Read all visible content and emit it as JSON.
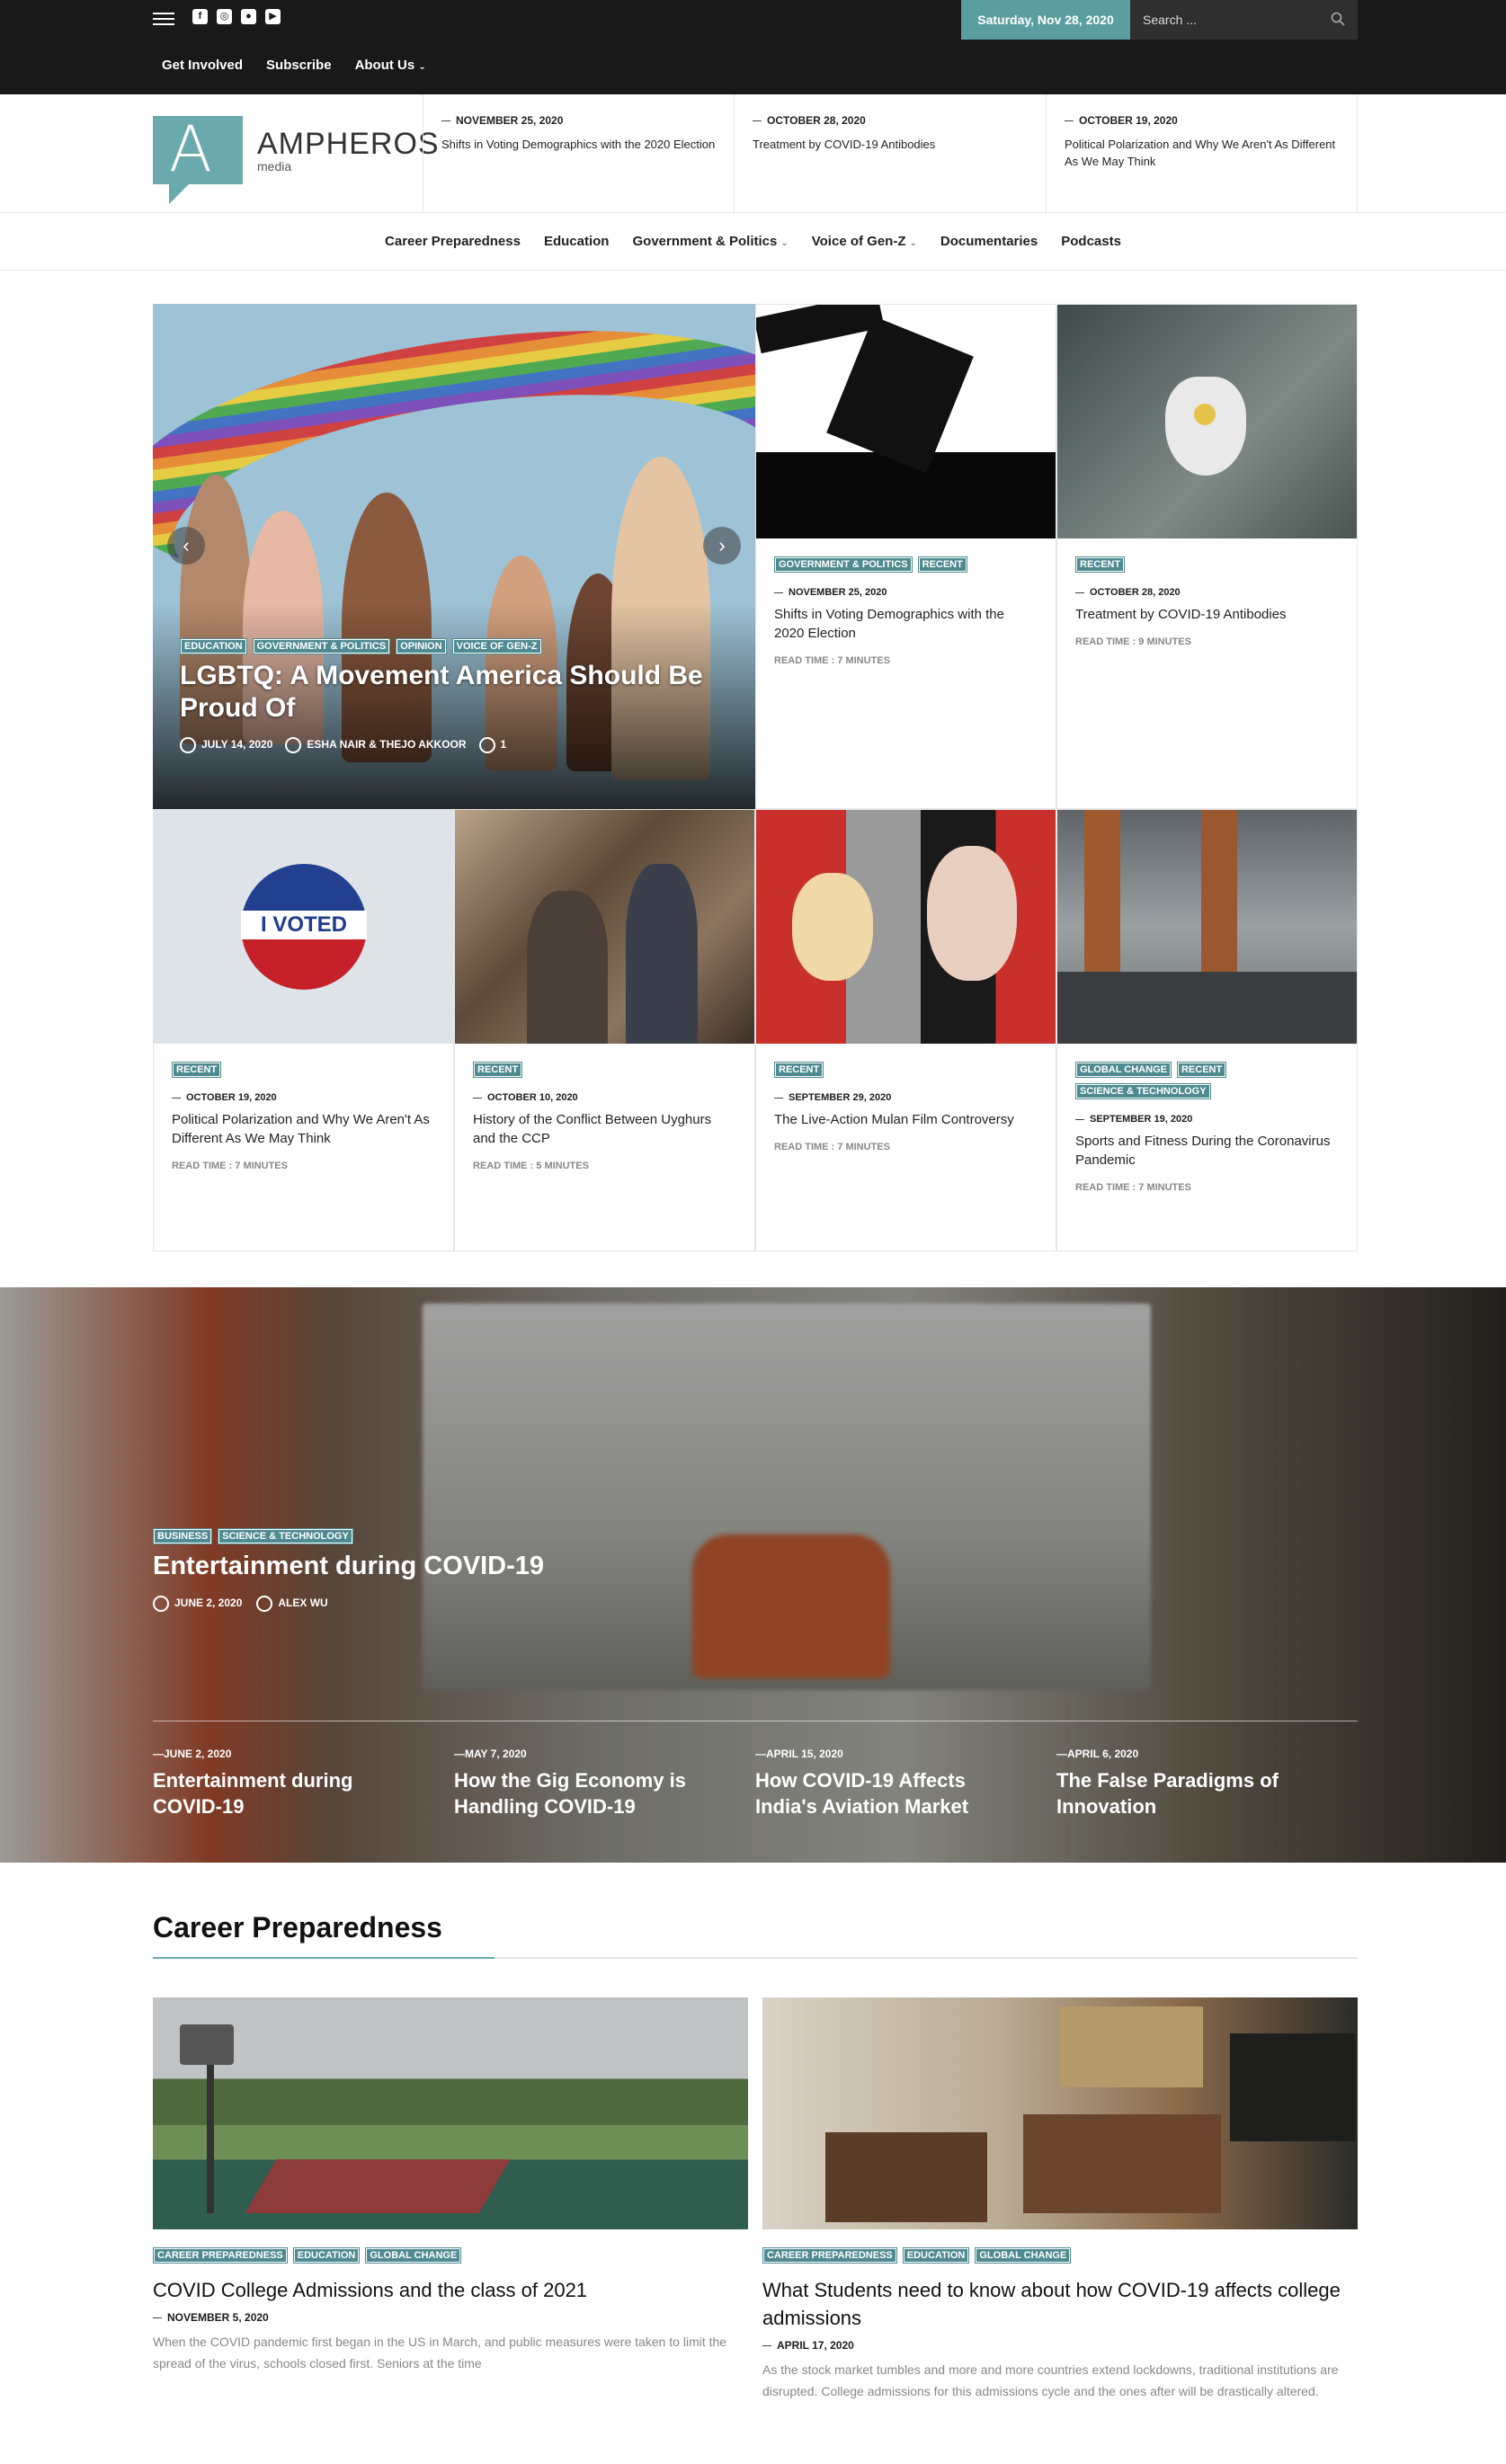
{
  "topbar": {
    "social_icons": [
      "facebook-icon",
      "instagram-icon",
      "reddit-icon",
      "youtube-icon"
    ],
    "date": "Saturday, Nov 28, 2020",
    "search_placeholder": "Search ...",
    "nav": [
      "Get Involved",
      "Subscribe",
      "About Us"
    ]
  },
  "logo": {
    "name": "AMPHEROS",
    "sub": "media"
  },
  "header_news": [
    {
      "date": "NOVEMBER 25, 2020",
      "title": "Shifts in Voting Demographics with the 2020 Election"
    },
    {
      "date": "OCTOBER 28, 2020",
      "title": "Treatment by COVID-19 Antibodies"
    },
    {
      "date": "OCTOBER 19, 2020",
      "title": "Political Polarization and Why We Aren't As Different As We May Think"
    }
  ],
  "main_nav": [
    "Career Preparedness",
    "Education",
    "Government & Politics",
    "Voice of Gen-Z",
    "Documentaries",
    "Podcasts"
  ],
  "hero": {
    "tags": [
      "EDUCATION",
      "GOVERNMENT & POLITICS",
      "OPINION",
      "VOICE OF GEN-Z"
    ],
    "title": "LGBTQ: A Movement America Should Be Proud Of",
    "date": "JULY 14, 2020",
    "author": "ESHA NAIR & THEJO AKKOOR",
    "comments": "1"
  },
  "cards": [
    {
      "tags": [
        "GOVERNMENT & POLITICS",
        "RECENT"
      ],
      "date": "NOVEMBER 25, 2020",
      "title": "Shifts in Voting Demographics with the 2020 Election",
      "read": "READ TIME : 7 MINUTES"
    },
    {
      "tags": [
        "RECENT"
      ],
      "date": "OCTOBER 28, 2020",
      "title": "Treatment by COVID-19 Antibodies",
      "read": "READ TIME : 9 MINUTES"
    },
    {
      "tags": [
        "RECENT"
      ],
      "date": "OCTOBER 19, 2020",
      "title": "Political Polarization and Why We Aren't As Different As We May Think",
      "read": "READ TIME : 7 MINUTES"
    },
    {
      "tags": [
        "RECENT"
      ],
      "date": "OCTOBER 10, 2020",
      "title": "History of the Conflict Between Uyghurs and the CCP",
      "read": "READ TIME : 5 MINUTES"
    },
    {
      "tags": [
        "RECENT"
      ],
      "date": "SEPTEMBER 29, 2020",
      "title": "The Live-Action Mulan Film Controversy",
      "read": "READ TIME : 7 MINUTES"
    },
    {
      "tags": [
        "GLOBAL CHANGE",
        "RECENT",
        "SCIENCE & TECHNOLOGY"
      ],
      "date": "SEPTEMBER 19, 2020",
      "title": "Sports and Fitness During the Coronavirus Pandemic",
      "read": "READ TIME : 7 MINUTES"
    }
  ],
  "i_voted_text": "I VOTED",
  "band": {
    "tags": [
      "BUSINESS",
      "SCIENCE & TECHNOLOGY"
    ],
    "title": "Entertainment during COVID-19",
    "date": "JUNE 2, 2020",
    "author": "ALEX WU",
    "items": [
      {
        "date": "JUNE 2, 2020",
        "title": "Entertainment during COVID-19"
      },
      {
        "date": "MAY 7, 2020",
        "title": "How the Gig Economy is Handling COVID-19"
      },
      {
        "date": "APRIL 15, 2020",
        "title": "How COVID-19 Affects India's Aviation Market"
      },
      {
        "date": "APRIL 6, 2020",
        "title": "The False Paradigms of Innovation"
      }
    ]
  },
  "section": {
    "title": "Career Preparedness",
    "posts": [
      {
        "tags": [
          "CAREER PREPAREDNESS",
          "EDUCATION",
          "GLOBAL CHANGE"
        ],
        "title": "COVID College Admissions and the class of 2021",
        "date": "NOVEMBER 5, 2020",
        "excerpt": "When the COVID pandemic first began in the US in March, and public measures were taken to limit the spread of the virus, schools closed first. Seniors at the time"
      },
      {
        "tags": [
          "CAREER PREPAREDNESS",
          "EDUCATION",
          "GLOBAL CHANGE"
        ],
        "title": "What Students need to know about how COVID-19 affects college admissions",
        "date": "APRIL 17, 2020",
        "excerpt": "As the stock market tumbles and more and more countries extend lockdowns, traditional institutions are disrupted. College admissions for this admissions cycle and the ones after will be drastically altered."
      }
    ]
  },
  "colors": {
    "accent": "#5a9ea0",
    "tag": "#4e8a90",
    "topbar": "#191919"
  }
}
